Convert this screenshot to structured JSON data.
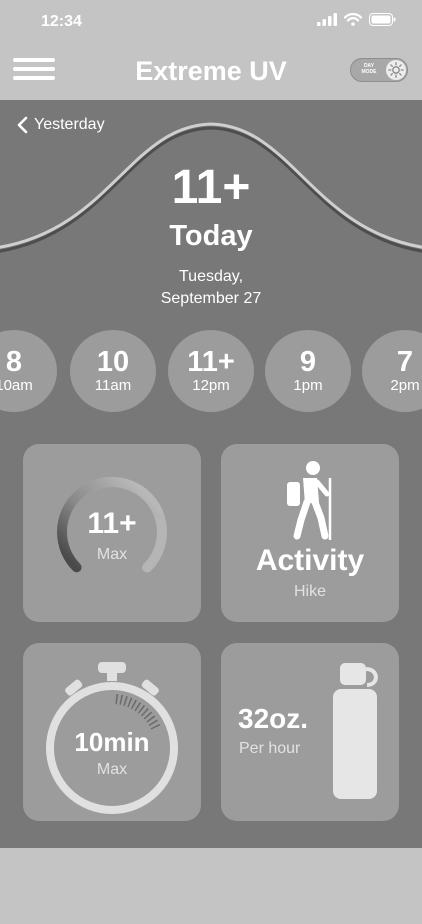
{
  "status": {
    "time": "12:34"
  },
  "header": {
    "title": "Extreme UV",
    "mode_label_line1": "DAY",
    "mode_label_line2": "MODE"
  },
  "nav": {
    "back_label": "Yesterday"
  },
  "hero": {
    "uv": "11+",
    "day": "Today",
    "date_line1": "Tuesday,",
    "date_line2": "September 27"
  },
  "hourly": [
    {
      "value": "8",
      "time": "10am"
    },
    {
      "value": "10",
      "time": "11am"
    },
    {
      "value": "11+",
      "time": "12pm"
    },
    {
      "value": "9",
      "time": "1pm"
    },
    {
      "value": "7",
      "time": "2pm"
    }
  ],
  "tiles": {
    "max_uv": {
      "value": "11+",
      "label": "Max",
      "gauge_level": 0.75
    },
    "activity": {
      "title": "Activity",
      "value": "Hike",
      "icon": "hiker-icon"
    },
    "exposure": {
      "value": "10min",
      "label": "Max",
      "icon": "stopwatch-icon"
    },
    "water": {
      "value": "32oz.",
      "label": "Per hour",
      "icon": "water-bottle-icon"
    }
  },
  "colors": {
    "background": "#787878",
    "chrome": "#c4c4c4",
    "tile": "#9c9c9c",
    "text": "#ffffff"
  }
}
